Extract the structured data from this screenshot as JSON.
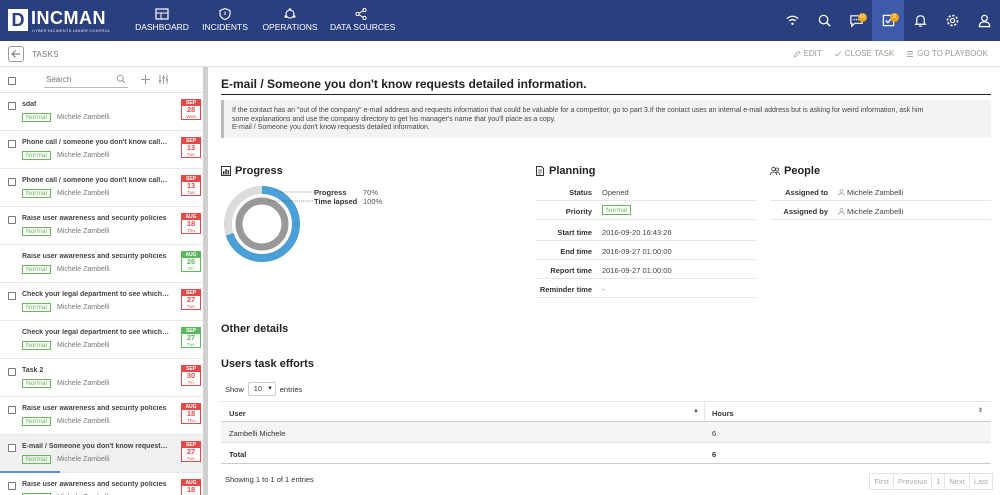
{
  "app": {
    "logo_letter": "D",
    "logo_text": "INCMAN",
    "logo_sub": "CYBER INCIDENTS UNDER CONTROL"
  },
  "nav": [
    {
      "label": "DASHBOARD",
      "icon": "dashboard-icon"
    },
    {
      "label": "INCIDENTS",
      "icon": "shield-icon"
    },
    {
      "label": "OPERATIONS",
      "icon": "operations-icon"
    },
    {
      "label": "DATA SOURCES",
      "icon": "share-icon"
    }
  ],
  "header_icons": {
    "chat_badge": "61",
    "tasks_badge": "11"
  },
  "subbar": {
    "title": "TASKS",
    "edit": "EDIT",
    "close_task": "CLOSE TASK",
    "go_to_playbook": "GO TO PLAYBOOK"
  },
  "list": {
    "search_placeholder": "Search",
    "tasks": [
      {
        "title": "sdaf",
        "priority": "Normal",
        "user": "Michele Zambelli",
        "month": "SEP",
        "day": "28",
        "weekday": "Wed",
        "color": "red",
        "checkbox": true
      },
      {
        "title": "Phone call / someone you don't know calls you...",
        "priority": "Normal",
        "user": "Michele Zambelli",
        "month": "SEP",
        "day": "13",
        "weekday": "Tue",
        "color": "red",
        "checkbox": true
      },
      {
        "title": "Phone call / someone you don't know calls you...",
        "priority": "Normal",
        "user": "Michele Zambelli",
        "month": "SEP",
        "day": "13",
        "weekday": "Tue",
        "color": "red",
        "checkbox": true
      },
      {
        "title": "Raise user awareness and security policies",
        "priority": "Normal",
        "user": "Michele Zambelli",
        "month": "AUG",
        "day": "18",
        "weekday": "Thu",
        "color": "red",
        "checkbox": true
      },
      {
        "title": "Raise user awareness and security policies",
        "priority": "Normal",
        "user": "Michele Zambelli",
        "month": "AUG",
        "day": "26",
        "weekday": "Fri",
        "color": "green",
        "checkbox": false
      },
      {
        "title": "Check your legal department to see which acti...",
        "priority": "Normal",
        "user": "Michele Zambelli",
        "month": "SEP",
        "day": "27",
        "weekday": "Tue",
        "color": "red",
        "checkbox": true
      },
      {
        "title": "Check your legal department to see which acti...",
        "priority": "Normal",
        "user": "Michele Zambelli",
        "month": "SEP",
        "day": "27",
        "weekday": "Tue",
        "color": "green",
        "checkbox": false
      },
      {
        "title": "Task 2",
        "priority": "Normal",
        "user": "Michele Zambelli",
        "month": "SEP",
        "day": "30",
        "weekday": "Fri",
        "color": "red",
        "checkbox": true
      },
      {
        "title": "Raise user awareness and security policies",
        "priority": "Normal",
        "user": "Michele Zambelli",
        "month": "AUG",
        "day": "18",
        "weekday": "Thu",
        "color": "red",
        "checkbox": true
      },
      {
        "title": "E-mail / Someone you don't know requests deta...",
        "priority": "Normal",
        "user": "Michele Zambelli",
        "month": "SEP",
        "day": "27",
        "weekday": "Tue",
        "color": "red",
        "checkbox": true
      },
      {
        "title": "Raise user awareness and security policies",
        "priority": "Normal",
        "user": "Michele Zambelli",
        "month": "AUG",
        "day": "18",
        "weekday": "Thu",
        "color": "red",
        "checkbox": true
      }
    ]
  },
  "main": {
    "title": "E-mail / Someone you don't know requests detailed information.",
    "description_line1": "If the contact has an \"out of the company\" e-mail address and requests information that could be valuable for a competitor, go to part 3.If the contact uses an internal e-mail address but is asking for weird information, ask him",
    "description_line2": "some explanations and use the company directory to get his manager's name that you'll place as a copy.",
    "description_line3": "E-mail / Someone you don't know requests detailed information.",
    "progress": {
      "title": "Progress",
      "progress_label": "Progress",
      "progress_value": "70%",
      "progress_fraction": 0.7,
      "time_label": "Time lapsed",
      "time_value": "100%",
      "time_fraction": 1.0,
      "outer_color": "#4a9fd6",
      "inner_color": "#999999"
    },
    "planning": {
      "title": "Planning",
      "status_label": "Status",
      "status_value": "Opened",
      "priority_label": "Priority",
      "priority_value": "Normal",
      "start_label": "Start time",
      "start_value": "2016-09-20 16:43:26",
      "end_label": "End time",
      "end_value": "2016-09-27 01:00:00",
      "report_label": "Report time",
      "report_value": "2016-09-27 01:00:00",
      "reminder_label": "Reminder time",
      "reminder_value": "-"
    },
    "people": {
      "title": "People",
      "assigned_to_label": "Assigned to",
      "assigned_to_value": "Michele Zambelli",
      "assigned_by_label": "Assigned by",
      "assigned_by_value": "Michele Zambelli"
    },
    "other_details": "Other details",
    "efforts": {
      "title": "Users task efforts",
      "show_label": "Show",
      "show_value": "10",
      "entries_label": "entries",
      "col_user": "User",
      "col_hours": "Hours",
      "row_user": "Zambelli Michele",
      "row_hours": "6",
      "total_label": "Total",
      "total_hours": "6",
      "showing": "Showing 1 to 1 of 1 entries",
      "pager": [
        "First",
        "Previous",
        "1",
        "Next",
        "Last"
      ]
    }
  }
}
